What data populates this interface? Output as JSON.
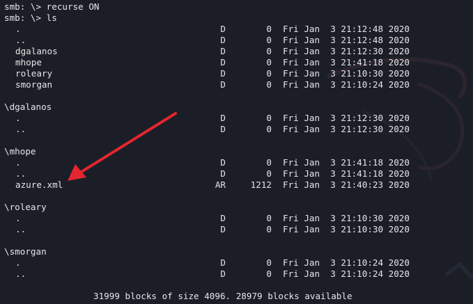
{
  "terminal": {
    "commands": [
      {
        "prompt": "smb: \\> ",
        "command": "recurse ON"
      },
      {
        "prompt": "smb: \\> ",
        "command": "ls"
      }
    ],
    "sections": [
      {
        "header": "",
        "entries": [
          {
            "name": ".",
            "attr": "D",
            "size": "0",
            "date": "Fri Jan  3 21:12:48 2020"
          },
          {
            "name": "..",
            "attr": "D",
            "size": "0",
            "date": "Fri Jan  3 21:12:48 2020"
          },
          {
            "name": "dgalanos",
            "attr": "D",
            "size": "0",
            "date": "Fri Jan  3 21:12:30 2020"
          },
          {
            "name": "mhope",
            "attr": "D",
            "size": "0",
            "date": "Fri Jan  3 21:41:18 2020"
          },
          {
            "name": "roleary",
            "attr": "D",
            "size": "0",
            "date": "Fri Jan  3 21:10:30 2020"
          },
          {
            "name": "smorgan",
            "attr": "D",
            "size": "0",
            "date": "Fri Jan  3 21:10:24 2020"
          }
        ]
      },
      {
        "header": "\\dgalanos",
        "entries": [
          {
            "name": ".",
            "attr": "D",
            "size": "0",
            "date": "Fri Jan  3 21:12:30 2020"
          },
          {
            "name": "..",
            "attr": "D",
            "size": "0",
            "date": "Fri Jan  3 21:12:30 2020"
          }
        ]
      },
      {
        "header": "\\mhope",
        "entries": [
          {
            "name": ".",
            "attr": "D",
            "size": "0",
            "date": "Fri Jan  3 21:41:18 2020"
          },
          {
            "name": "..",
            "attr": "D",
            "size": "0",
            "date": "Fri Jan  3 21:41:18 2020"
          },
          {
            "name": "azure.xml",
            "attr": "AR",
            "size": "1212",
            "date": "Fri Jan  3 21:40:23 2020"
          }
        ]
      },
      {
        "header": "\\roleary",
        "entries": [
          {
            "name": ".",
            "attr": "D",
            "size": "0",
            "date": "Fri Jan  3 21:10:30 2020"
          },
          {
            "name": "..",
            "attr": "D",
            "size": "0",
            "date": "Fri Jan  3 21:10:30 2020"
          }
        ]
      },
      {
        "header": "\\smorgan",
        "entries": [
          {
            "name": ".",
            "attr": "D",
            "size": "0",
            "date": "Fri Jan  3 21:10:24 2020"
          },
          {
            "name": "..",
            "attr": "D",
            "size": "0",
            "date": "Fri Jan  3 21:10:24 2020"
          }
        ]
      }
    ],
    "footer": "31999 blocks of size 4096. 28979 blocks available"
  },
  "annotation": {
    "icon": "arrow-icon",
    "target": "azure.xml",
    "color": "#e3262f"
  },
  "colors": {
    "background": "#1b1e27",
    "text": "#e6e6e6"
  }
}
